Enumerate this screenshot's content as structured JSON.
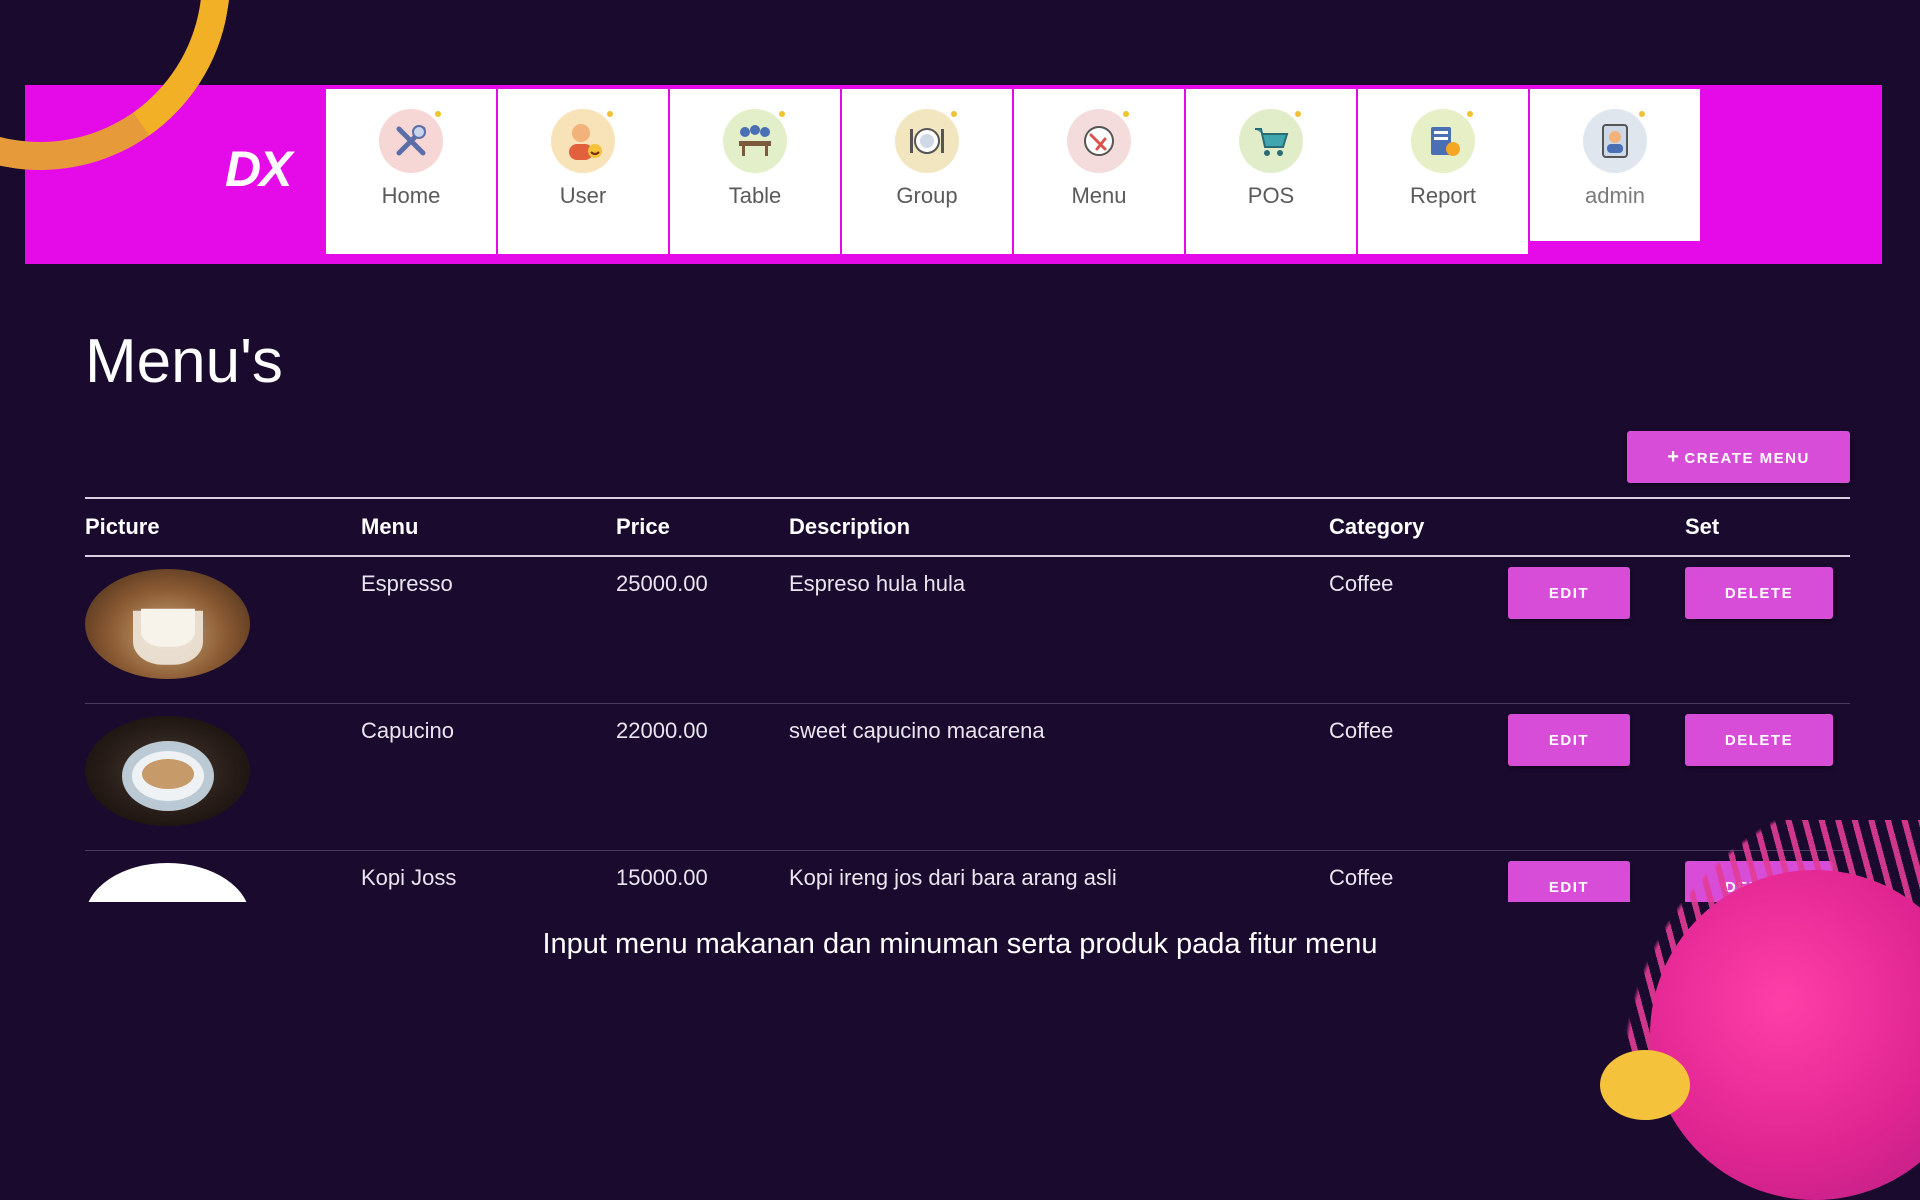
{
  "brand": {
    "logo_text": "DX"
  },
  "nav": {
    "items": [
      {
        "label": "Home",
        "icon": "utensils-icon"
      },
      {
        "label": "User",
        "icon": "user-icon"
      },
      {
        "label": "Table",
        "icon": "table-icon"
      },
      {
        "label": "Group",
        "icon": "plate-icon"
      },
      {
        "label": "Menu",
        "icon": "menu-icon"
      },
      {
        "label": "POS",
        "icon": "cart-icon"
      },
      {
        "label": "Report",
        "icon": "report-icon"
      },
      {
        "label": "admin",
        "icon": "admin-avatar-icon"
      }
    ]
  },
  "page": {
    "title": "Menu's",
    "create_button": "CREATE MENU"
  },
  "table": {
    "headers": {
      "picture": "Picture",
      "menu": "Menu",
      "price": "Price",
      "description": "Description",
      "category": "Category",
      "set": "Set"
    },
    "rows": [
      {
        "menu": "Espresso",
        "price": "25000.00",
        "description": "Espreso hula hula",
        "category": "Coffee",
        "edit": "EDIT",
        "delete": "DELETE"
      },
      {
        "menu": "Capucino",
        "price": "22000.00",
        "description": "sweet capucino macarena",
        "category": "Coffee",
        "edit": "EDIT",
        "delete": "DELETE"
      },
      {
        "menu": "Kopi Joss",
        "price": "15000.00",
        "description": "Kopi ireng jos dari bara arang asli",
        "category": "Coffee",
        "edit": "EDIT",
        "delete": "DELETE"
      }
    ]
  },
  "caption": "Input menu makanan dan minuman serta produk pada fitur menu",
  "colors": {
    "background": "#190a2e",
    "navbar": "#e40be8",
    "button": "#d84dd8",
    "accent_orange": "#f1b025",
    "accent_pink": "#e02591"
  }
}
